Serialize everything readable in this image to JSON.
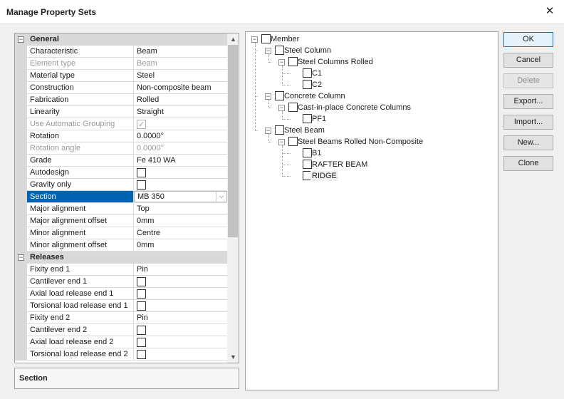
{
  "window": {
    "title": "Manage Property Sets",
    "close_glyph": "✕"
  },
  "grid": {
    "categories": [
      {
        "label": "General",
        "rows": [
          {
            "name": "Characteristic",
            "value": "Beam"
          },
          {
            "name": "Element type",
            "value": "Beam",
            "disabled": true
          },
          {
            "name": "Material type",
            "value": "Steel"
          },
          {
            "name": "Construction",
            "value": "Non-composite beam"
          },
          {
            "name": "Fabrication",
            "value": "Rolled"
          },
          {
            "name": "Linearity",
            "value": "Straight"
          },
          {
            "name": "Use Automatic Grouping",
            "checkbox": true,
            "checked": true,
            "disabled": true
          },
          {
            "name": "Rotation",
            "value": "0.0000°"
          },
          {
            "name": "Rotation angle",
            "value": "0.0000°",
            "disabled": true
          },
          {
            "name": "Grade",
            "value": "Fe 410 WA"
          },
          {
            "name": "Autodesign",
            "checkbox": true,
            "checked": false
          },
          {
            "name": "Gravity only",
            "checkbox": true,
            "checked": false
          },
          {
            "name": "Section",
            "value": "MB 350",
            "selected": true,
            "combo": true
          },
          {
            "name": "Major alignment",
            "value": "Top"
          },
          {
            "name": "Major alignment offset",
            "value": "0mm"
          },
          {
            "name": "Minor alignment",
            "value": "Centre"
          },
          {
            "name": "Minor alignment offset",
            "value": "0mm"
          }
        ]
      },
      {
        "label": "Releases",
        "rows": [
          {
            "name": "Fixity end 1",
            "value": "Pin"
          },
          {
            "name": "Cantilever end 1",
            "checkbox": true,
            "checked": false
          },
          {
            "name": "Axial load release end 1",
            "checkbox": true,
            "checked": false
          },
          {
            "name": "Torsional load release end 1",
            "checkbox": true,
            "checked": false
          },
          {
            "name": "Fixity end 2",
            "value": "Pin"
          },
          {
            "name": "Cantilever end 2",
            "checkbox": true,
            "checked": false
          },
          {
            "name": "Axial load release end 2",
            "checkbox": true,
            "checked": false
          },
          {
            "name": "Torsional load release end 2",
            "checkbox": true,
            "checked": false
          }
        ]
      }
    ],
    "description_title": "Section"
  },
  "tree": {
    "nodes": [
      {
        "label": "Member",
        "level": 0,
        "expander": true
      },
      {
        "label": "Steel Column",
        "level": 1,
        "expander": true
      },
      {
        "label": "Steel Columns Rolled",
        "level": 2,
        "expander": true
      },
      {
        "label": "C1",
        "level": 3
      },
      {
        "label": "C2",
        "level": 3
      },
      {
        "label": "Concrete Column",
        "level": 1,
        "expander": true
      },
      {
        "label": "Cast-in-place Concrete Columns",
        "level": 2,
        "expander": true
      },
      {
        "label": "PF1",
        "level": 3
      },
      {
        "label": "Steel Beam",
        "level": 1,
        "expander": true
      },
      {
        "label": "Steel Beams Rolled Non-Composite",
        "level": 2,
        "expander": true
      },
      {
        "label": "B1",
        "level": 3
      },
      {
        "label": "RAFTER BEAM",
        "level": 3
      },
      {
        "label": "RIDGE",
        "level": 3,
        "highlight": true
      }
    ]
  },
  "buttons": [
    {
      "label": "OK",
      "default": true
    },
    {
      "label": "Cancel"
    },
    {
      "label": "Delete",
      "disabled": true
    },
    {
      "label": "Export..."
    },
    {
      "label": "Import..."
    },
    {
      "label": "New..."
    },
    {
      "label": "Clone"
    }
  ]
}
